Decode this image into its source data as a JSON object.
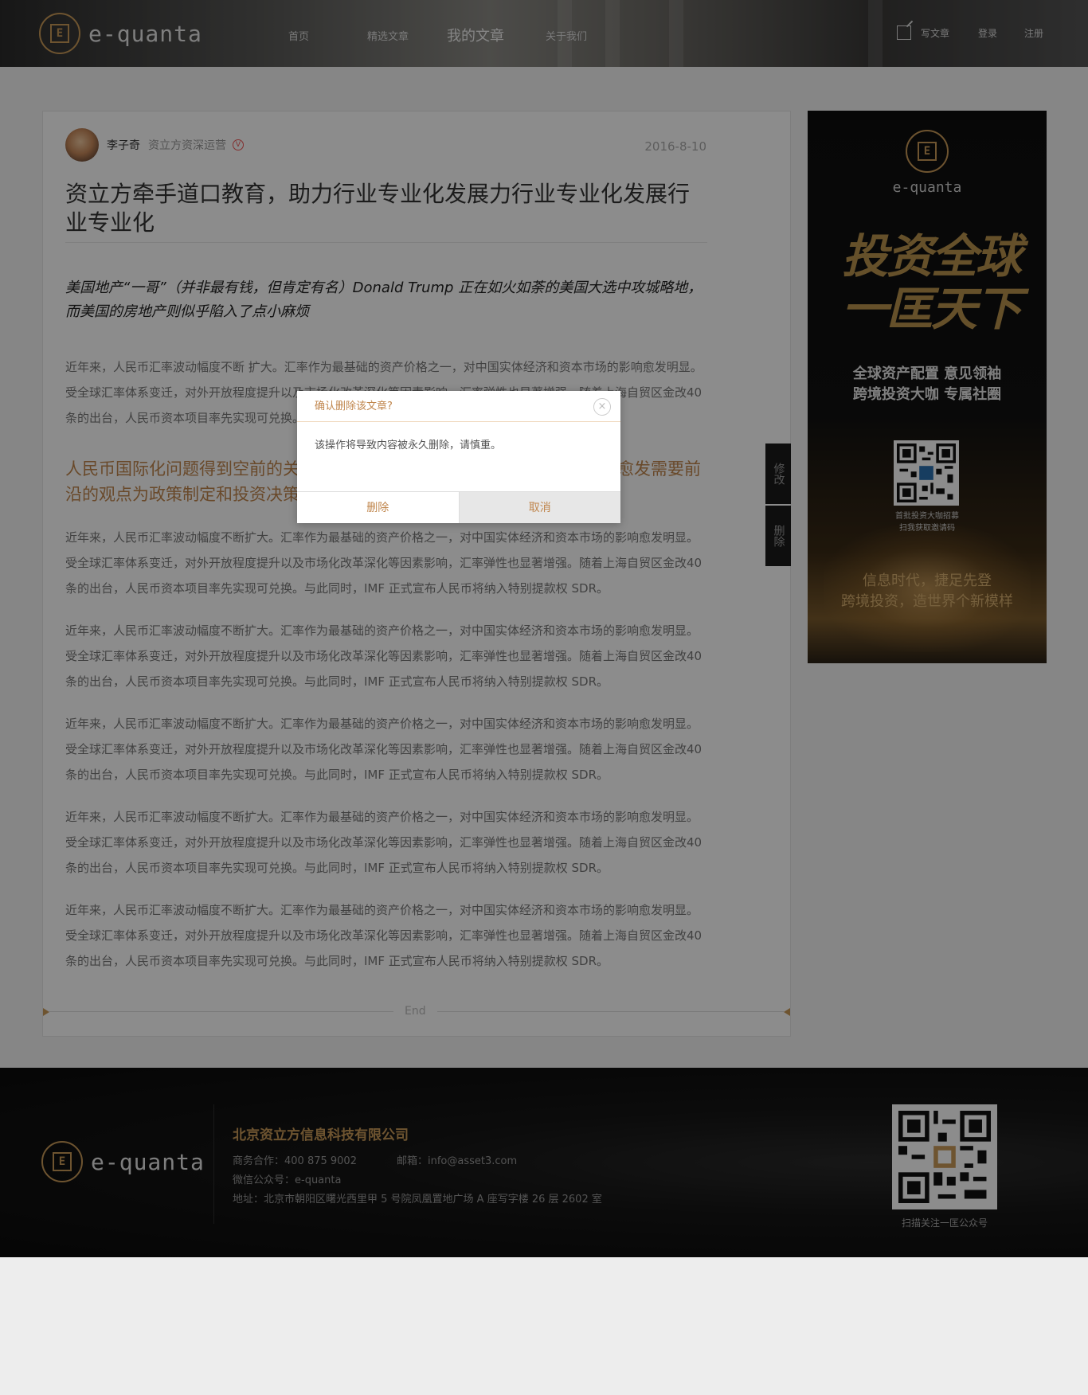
{
  "header": {
    "logo_text": "e-quanta",
    "nav": [
      "首页",
      "精选文章",
      "我的文章",
      "关于我们"
    ],
    "active_nav": "我的文章",
    "write_label": "写文章",
    "login_label": "登录",
    "register_label": "注册"
  },
  "article": {
    "author_name": "李子奇",
    "author_title": "资立方资深运营",
    "vip_badge": "V",
    "date": "2016-8-10",
    "title": "资立方牵手道口教育，助力行业专业化发展力行业专业化发展行业专业化",
    "lead": "美国地产“一哥”（并非最有钱，但肯定有名）Donald Trump 正在如火如荼的美国大选中攻城略地，而美国的房地产则似乎陷入了点小麻烦",
    "para_first": "近年来，人民币汇率波动幅度不断 扩大。汇率作为最基础的资产价格之一，对中国实体经济和资本市场的影响愈发明显。受全球汇率体系变迁，对外开放程度提升以及市场化改革深化等因素影响，汇率弹性也显著增强。随着上海自贸区金改40 条的出台，人民币资本项目率先实现可兑换。与此同时，IMF 正式宣布人民币将纳入特别提款权 SDR。",
    "subhead": "人民币国际化问题得到空前的关注，汇率的市场化进程也越来越快，投资者愈发需要前沿的观点为政策制定和投资决策提供参考",
    "paragraphs": [
      "近年来，人民币汇率波动幅度不断扩大。汇率作为最基础的资产价格之一，对中国实体经济和资本市场的影响愈发明显。受全球汇率体系变迁，对外开放程度提升以及市场化改革深化等因素影响，汇率弹性也显著增强。随着上海自贸区金改40 条的出台，人民币资本项目率先实现可兑换。与此同时，IMF 正式宣布人民币将纳入特别提款权 SDR。",
      "近年来，人民币汇率波动幅度不断扩大。汇率作为最基础的资产价格之一，对中国实体经济和资本市场的影响愈发明显。受全球汇率体系变迁，对外开放程度提升以及市场化改革深化等因素影响，汇率弹性也显著增强。随着上海自贸区金改40 条的出台，人民币资本项目率先实现可兑换。与此同时，IMF 正式宣布人民币将纳入特别提款权 SDR。",
      "近年来，人民币汇率波动幅度不断扩大。汇率作为最基础的资产价格之一，对中国实体经济和资本市场的影响愈发明显。受全球汇率体系变迁，对外开放程度提升以及市场化改革深化等因素影响，汇率弹性也显著增强。随着上海自贸区金改40 条的出台，人民币资本项目率先实现可兑换。与此同时，IMF 正式宣布人民币将纳入特别提款权 SDR。",
      "近年来，人民币汇率波动幅度不断扩大。汇率作为最基础的资产价格之一，对中国实体经济和资本市场的影响愈发明显。受全球汇率体系变迁，对外开放程度提升以及市场化改革深化等因素影响，汇率弹性也显著增强。随着上海自贸区金改40 条的出台，人民币资本项目率先实现可兑换。与此同时，IMF 正式宣布人民币将纳入特别提款权 SDR。",
      "近年来，人民币汇率波动幅度不断扩大。汇率作为最基础的资产价格之一，对中国实体经济和资本市场的影响愈发明显。受全球汇率体系变迁，对外开放程度提升以及市场化改革深化等因素影响，汇率弹性也显著增强。随着上海自贸区金改40 条的出台，人民币资本项目率先实现可兑换。与此同时，IMF 正式宣布人民币将纳入特别提款权 SDR。"
    ],
    "end_label": "End"
  },
  "side_actions": {
    "edit_label": "修改",
    "delete_label": "删除"
  },
  "ad": {
    "logo_text": "e-quanta",
    "calligraphy": "投资全球一匡天下",
    "tagline_1": "全球资产配置 意见领袖",
    "tagline_2": "跨境投资大咖 专属社圈",
    "qr_caption_1": "首批投资大咖招募",
    "qr_caption_2": "扫我获取邀请码",
    "slogan_1": "信息时代，捷足先登",
    "slogan_2": "跨境投资，造世界个新模样"
  },
  "footer": {
    "logo_text": "e-quanta",
    "company": "北京资立方信息科技有限公司",
    "business": "商务合作：400 875 9002",
    "email": "邮箱：info@asset3.com",
    "wechat": "微信公众号：e-quanta",
    "address": "地址：北京市朝阳区曙光西里甲 5 号院凤凰置地广场 A 座写字楼 26 层 2602 室",
    "qr_caption": "扫描关注一匡公众号"
  },
  "modal": {
    "title": "确认删除该文章?",
    "message": "该操作将导致内容被永久删除，请慎重。",
    "confirm_label": "删除",
    "cancel_label": "取消",
    "close_glyph": "×"
  },
  "colors": {
    "accent": "#c99a58",
    "accent_text": "#c0864d",
    "footer_bg": "#0b0b0b"
  }
}
